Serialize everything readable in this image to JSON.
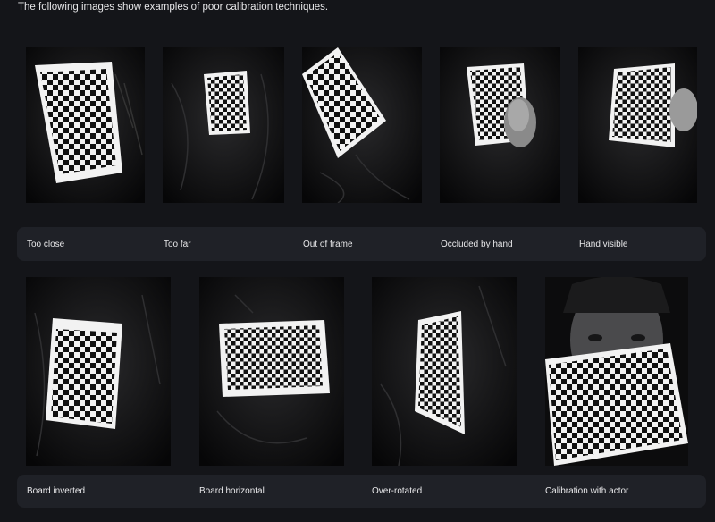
{
  "intro_text": "The following images show examples of poor calibration techniques.",
  "examples_row_1": [
    {
      "caption": "Too close"
    },
    {
      "caption": "Too far"
    },
    {
      "caption": "Out of frame"
    },
    {
      "caption": "Occluded by hand"
    },
    {
      "caption": "Hand visible"
    }
  ],
  "examples_row_2": [
    {
      "caption": "Board inverted"
    },
    {
      "caption": "Board horizontal"
    },
    {
      "caption": "Over-rotated"
    },
    {
      "caption": "Calibration with actor"
    }
  ],
  "colors": {
    "page_background": "#141519",
    "caption_bar": "#1f2127",
    "text": "#e8e8ea"
  }
}
